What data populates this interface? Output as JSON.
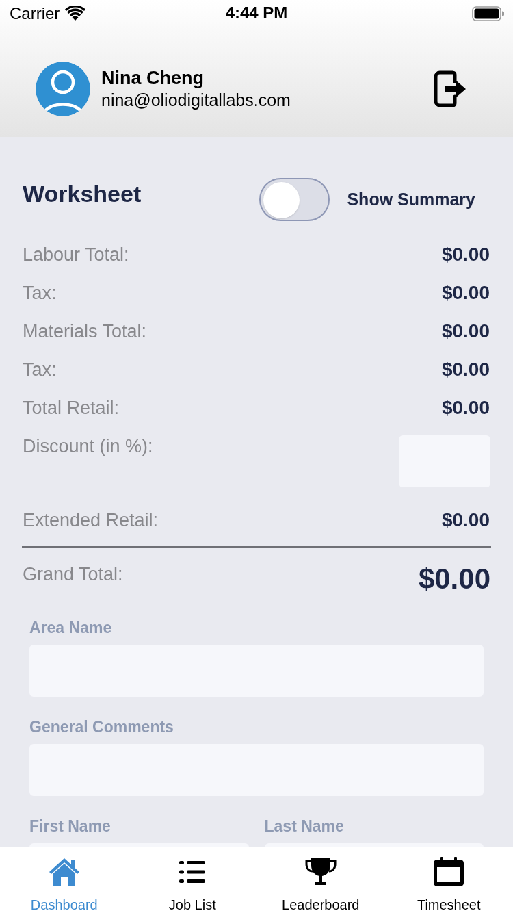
{
  "status_bar": {
    "carrier": "Carrier",
    "time": "4:44 PM"
  },
  "profile": {
    "name": "Nina Cheng",
    "email": "nina@oliodigitallabs.com"
  },
  "worksheet": {
    "title": "Worksheet",
    "summary_toggle": {
      "label": "Show Summary",
      "on": false
    },
    "rows": [
      {
        "kind": "amount",
        "label": "Labour Total:",
        "value": "$0.00"
      },
      {
        "kind": "amount",
        "label": "Tax:",
        "value": "$0.00"
      },
      {
        "kind": "amount",
        "label": "Materials Total:",
        "value": "$0.00"
      },
      {
        "kind": "amount",
        "label": "Tax:",
        "value": "$0.00"
      },
      {
        "kind": "amount",
        "label": "Total Retail:",
        "value": "$0.00"
      },
      {
        "kind": "input",
        "label": "Discount (in %):"
      },
      {
        "kind": "amount",
        "label": "Extended Retail:",
        "value": "$0.00"
      },
      {
        "kind": "total",
        "label": "Grand Total:",
        "value": "$0.00"
      }
    ]
  },
  "form": {
    "rows": [
      {
        "fields": [
          {
            "label": "Area Name"
          }
        ]
      },
      {
        "fields": [
          {
            "label": "General Comments"
          }
        ]
      },
      {
        "fields": [
          {
            "label": "First Name"
          },
          {
            "label": "Last Name"
          }
        ]
      }
    ]
  },
  "tab_bar": {
    "tabs": [
      {
        "label": "Dashboard",
        "selected": true
      },
      {
        "label": "Job List",
        "selected": false
      },
      {
        "label": "Leaderboard",
        "selected": false
      },
      {
        "label": "Timesheet",
        "selected": false
      }
    ]
  }
}
